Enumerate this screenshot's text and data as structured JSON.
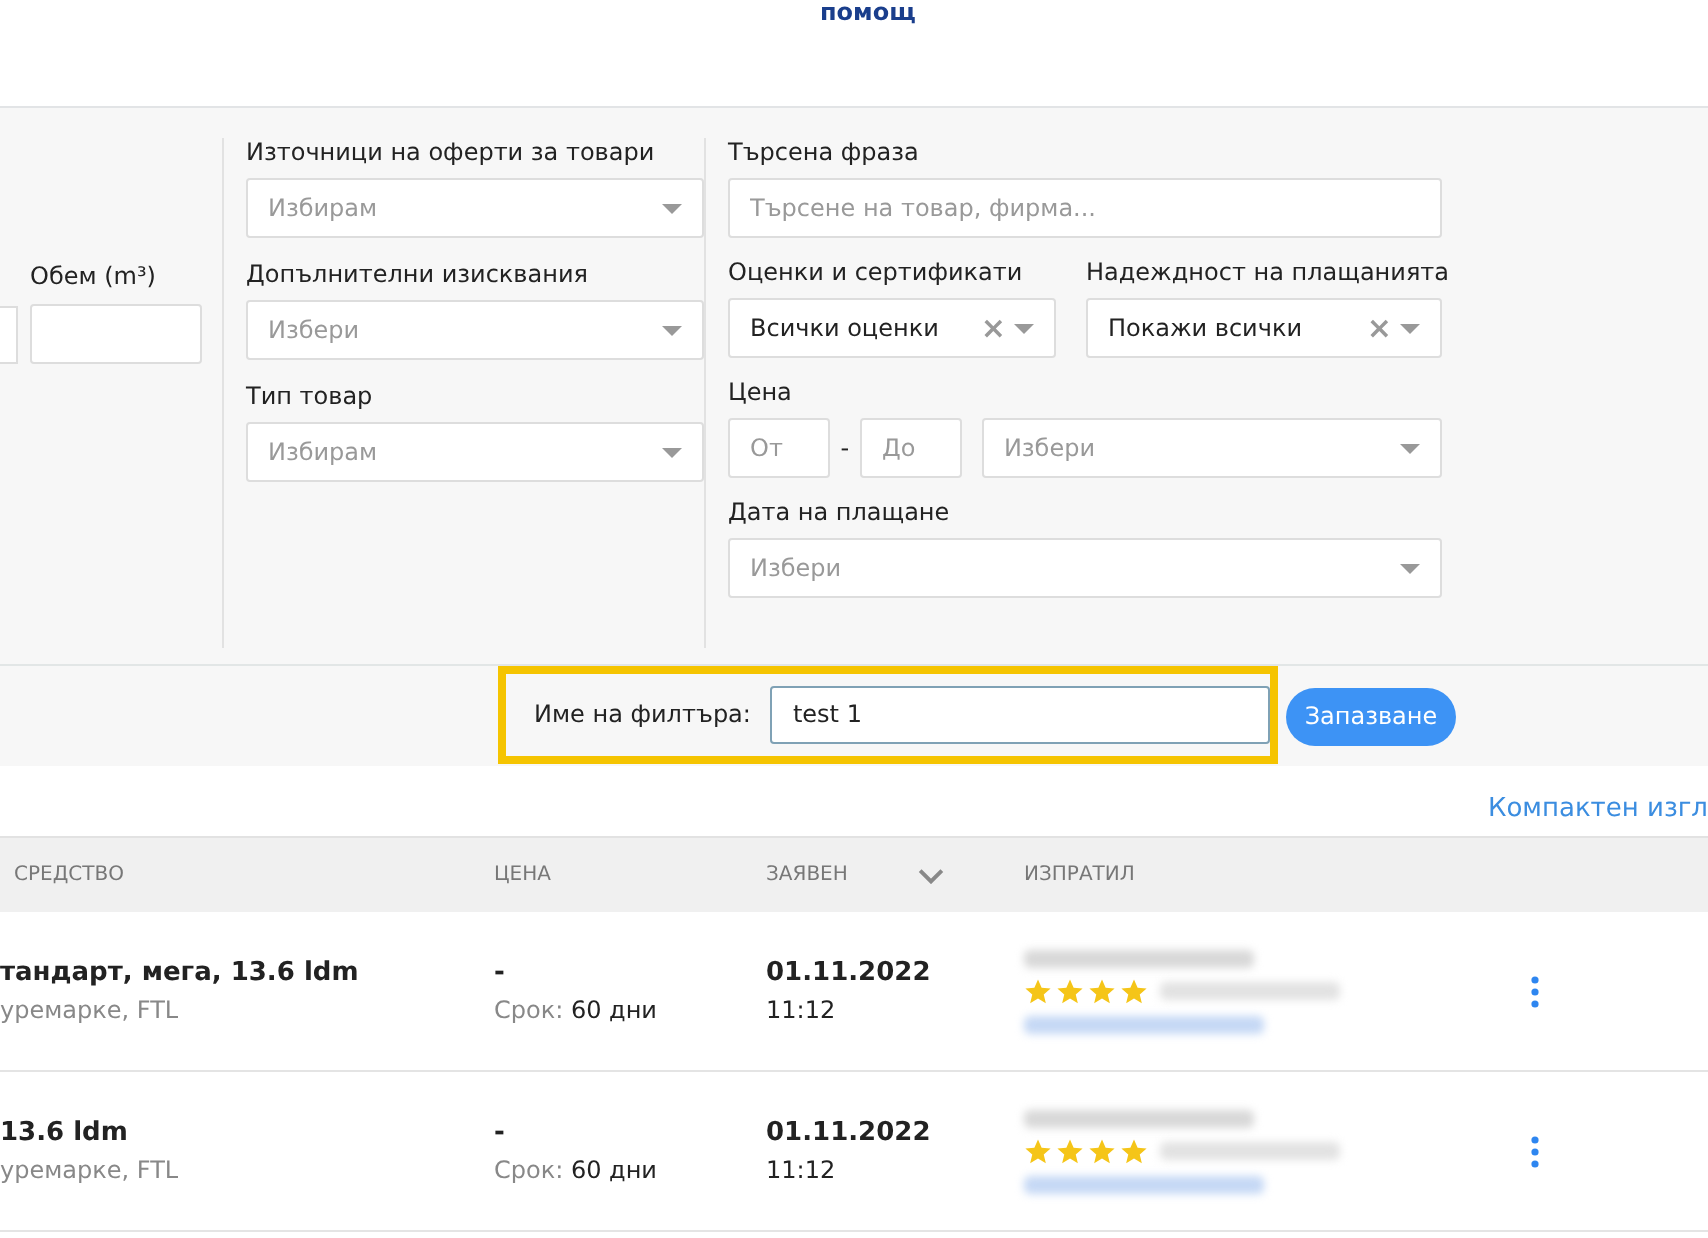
{
  "header": {
    "link": "помощ"
  },
  "filters": {
    "left_column": {
      "volume_label": "Обем (m³)"
    },
    "middle_column": [
      {
        "label": "Източници на оферти за товари",
        "placeholder": "Избирам"
      },
      {
        "label": "Допълнителни изисквания",
        "placeholder": "Избери"
      },
      {
        "label": "Тип товар",
        "placeholder": "Избирам"
      }
    ],
    "search": {
      "label": "Търсена фраза",
      "placeholder": "Търсене на товар, фирма..."
    },
    "ratings": {
      "label": "Оценки и сертификати",
      "value": "Всички оценки",
      "clear": "×"
    },
    "payment_reliability": {
      "label": "Надеждност на плащанията",
      "value": "Покажи всички",
      "clear": "×"
    },
    "price": {
      "label": "Цена",
      "from_placeholder": "От",
      "separator": "-",
      "to_placeholder": "До",
      "currency_placeholder": "Избери"
    },
    "payment_date": {
      "label": "Дата на плащане",
      "placeholder": "Избери"
    },
    "filter_name": {
      "label": "Име на филтъра:",
      "value": "test 1"
    },
    "save_button": "Запазване"
  },
  "compact_view_link": "Компактен изгл",
  "table": {
    "columns": [
      "СРЕДСТВО",
      "ЦЕНА",
      "ЗАЯВЕН",
      "ИЗПРАТИЛ"
    ],
    "rows": [
      {
        "title": "тандарт, мега, 13.6 ldm",
        "subtitle": "уремарке, FTL",
        "price": "-",
        "term_label": "Срок:",
        "term": "60 дни",
        "date": "01.11.2022",
        "time": "11:12",
        "stars": 4
      },
      {
        "title": "13.6 ldm",
        "subtitle": "уремарке, FTL",
        "price": "-",
        "term_label": "Срок:",
        "term": "60 дни",
        "date": "01.11.2022",
        "time": "11:12",
        "stars": 4
      }
    ]
  }
}
